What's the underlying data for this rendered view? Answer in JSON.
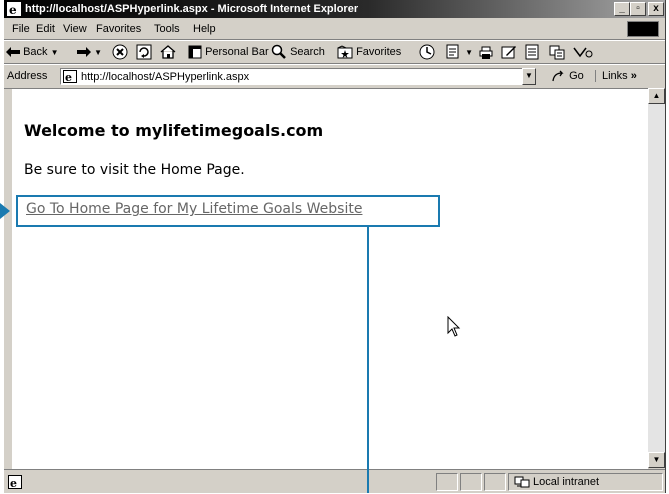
{
  "window": {
    "title": "http://localhost/ASPHyperlink.aspx - Microsoft Internet Explorer",
    "controls": {
      "minimize": "_",
      "maximize": "▫",
      "close": "x"
    }
  },
  "menu": [
    "File",
    "Edit",
    "View",
    "Favorites",
    "Tools",
    "Help"
  ],
  "toolbar": {
    "back": "Back",
    "personal_bar": "Personal Bar",
    "search": "Search",
    "favorites": "Favorites"
  },
  "address": {
    "label": "Address",
    "url": "http://localhost/ASPHyperlink.aspx",
    "go": "Go",
    "links": "Links"
  },
  "page": {
    "heading": "Welcome to mylifetimegoals.com",
    "paragraph": "Be sure to visit the Home Page.",
    "link_text": "Go To Home Page for My Lifetime Goals Website"
  },
  "status": {
    "zone": "Local intranet"
  },
  "colors": {
    "callout": "#1a7ab0",
    "link": "#666666"
  }
}
